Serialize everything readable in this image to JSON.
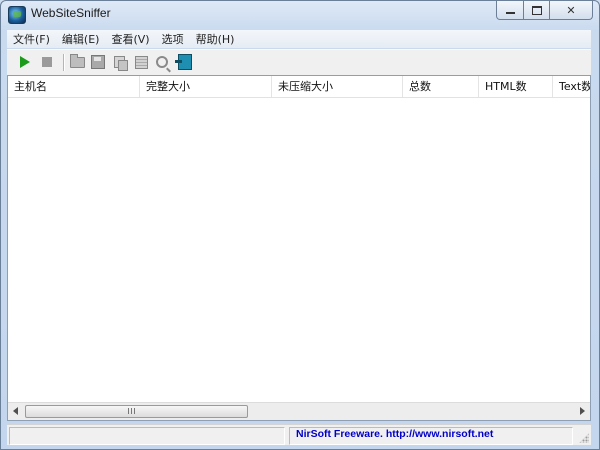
{
  "window": {
    "title": "WebSiteSniffer",
    "app_icon": "globe-icon"
  },
  "title_buttons": {
    "minimize": "minimize-icon",
    "maximize": "maximize-icon",
    "close": "✕"
  },
  "menu": [
    "文件(F)",
    "编辑(E)",
    "查看(V)",
    "选项",
    "帮助(H)"
  ],
  "toolbar": [
    {
      "name": "start-capture",
      "icon": "play-icon",
      "color": "#1a9b1a"
    },
    {
      "name": "stop-capture",
      "icon": "stop-icon"
    },
    {
      "name": "open-folder",
      "icon": "folder-icon"
    },
    {
      "name": "save",
      "icon": "save-icon"
    },
    {
      "name": "copy",
      "icon": "copy-icon"
    },
    {
      "name": "properties",
      "icon": "properties-icon"
    },
    {
      "name": "find",
      "icon": "find-icon"
    },
    {
      "name": "exit",
      "icon": "exit-icon",
      "color": "#1e8fb0"
    }
  ],
  "table": {
    "columns": [
      "主机名",
      "完整大小",
      "未压缩大小",
      "总数",
      "HTML数",
      "Text数"
    ],
    "rows": []
  },
  "statusbar": {
    "link_text": "NirSoft Freeware.  http://www.nirsoft.net",
    "link_color": "#0000c8"
  }
}
